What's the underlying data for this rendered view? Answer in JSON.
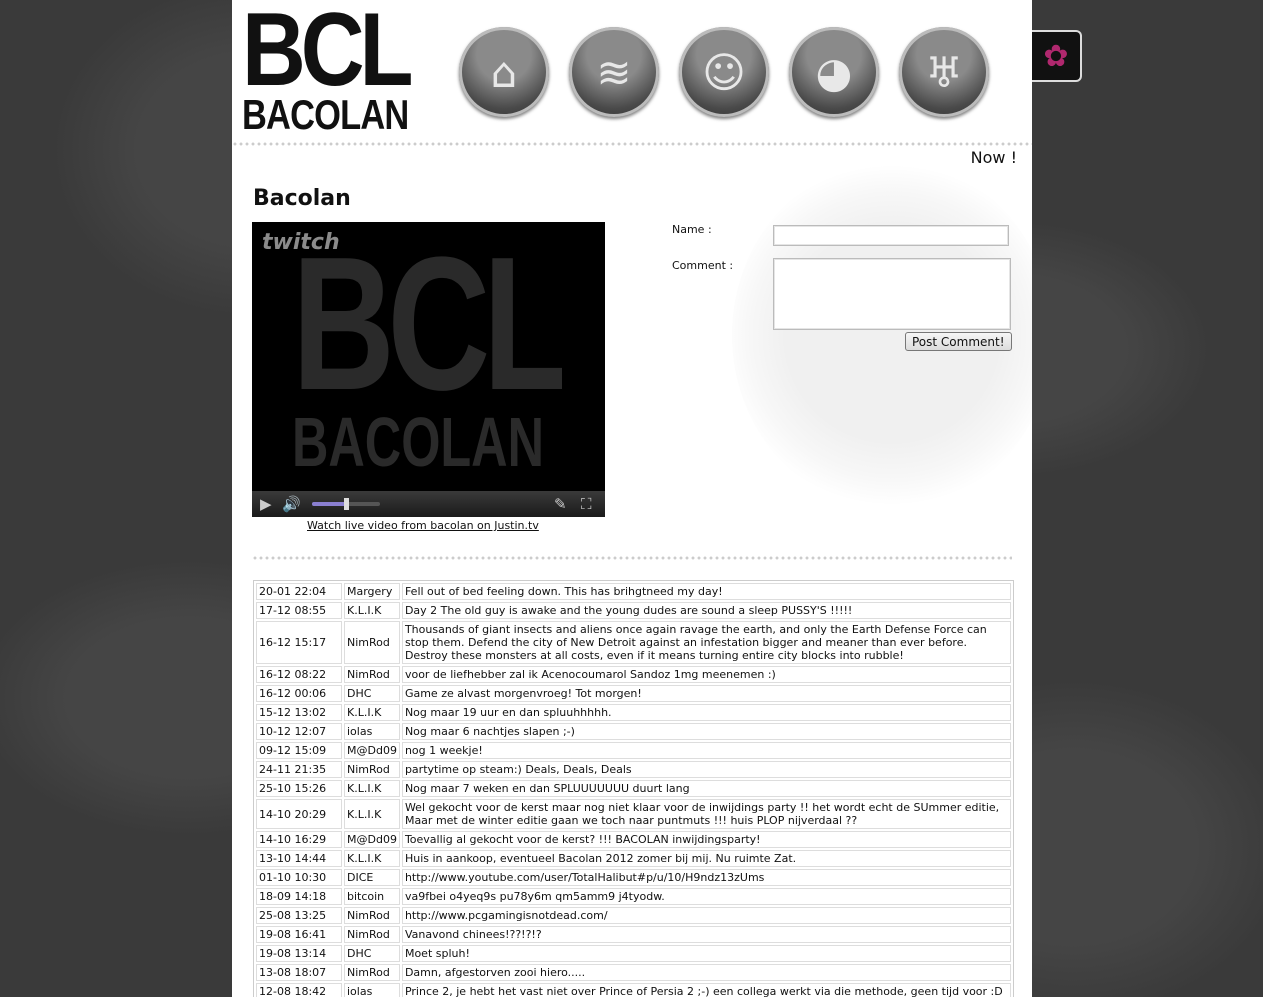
{
  "logo": {
    "top": "BCL",
    "bottom": "BACOLAN"
  },
  "nav": [
    {
      "name": "home",
      "icon": "home-icon",
      "glyph": "⌂"
    },
    {
      "name": "waves",
      "icon": "waves-icon",
      "glyph": "≋"
    },
    {
      "name": "people",
      "icon": "people-icon",
      "glyph": "☺"
    },
    {
      "name": "pacman",
      "icon": "pacman-icon",
      "glyph": "◕"
    },
    {
      "name": "bat",
      "icon": "bat-icon",
      "glyph": "♅"
    }
  ],
  "side_tab": {
    "icon": "flower-icon",
    "glyph": "✿"
  },
  "now_text": "Now !",
  "page_title": "Bacolan",
  "player": {
    "brand": "twitch",
    "screen_top": "BCL",
    "screen_bottom": "BACOLAN",
    "volume": 0.5,
    "link_text": "Watch live video from bacolan on Justin.tv"
  },
  "form": {
    "name_label": "Name :",
    "comment_label": "Comment :",
    "name_value": "",
    "comment_value": "",
    "submit_label": "Post Comment!"
  },
  "comments": [
    {
      "date": "20-01 22:04",
      "user": "Margery",
      "text": "Fell out of bed feeling down. This has brihgtneed my day!"
    },
    {
      "date": "17-12 08:55",
      "user": "K.L.I.K",
      "text": "Day 2 The old guy is awake and the young dudes are sound a sleep PUSSY'S !!!!!"
    },
    {
      "date": "16-12 15:17",
      "user": "NimRod",
      "text": "Thousands of giant insects and aliens once again ravage the earth, and only the Earth Defense Force can stop them. Defend the city of New Detroit against an infestation bigger and meaner than ever before. Destroy these monsters at all costs, even if it means turning entire city blocks into rubble!"
    },
    {
      "date": "16-12 08:22",
      "user": "NimRod",
      "text": "voor de liefhebber zal ik Acenocoumarol Sandoz 1mg meenemen :)"
    },
    {
      "date": "16-12 00:06",
      "user": "DHC",
      "text": "Game ze alvast morgenvroeg! Tot morgen!"
    },
    {
      "date": "15-12 13:02",
      "user": "K.L.I.K",
      "text": "Nog maar 19 uur en dan spluuhhhhh."
    },
    {
      "date": "10-12 12:07",
      "user": "iolas",
      "text": "Nog maar 6 nachtjes slapen ;-)"
    },
    {
      "date": "09-12 15:09",
      "user": "M@Dd09",
      "text": "nog 1 weekje!"
    },
    {
      "date": "24-11 21:35",
      "user": "NimRod",
      "text": "partytime op steam:) Deals, Deals, Deals"
    },
    {
      "date": "25-10 15:26",
      "user": "K.L.I.K",
      "text": "Nog maar 7 weken en dan SPLUUUUUUU duurt lang"
    },
    {
      "date": "14-10 20:29",
      "user": "K.L.I.K",
      "text": "Wel gekocht voor de kerst maar nog niet klaar voor de inwijdings party !! het wordt echt de SUmmer editie, Maar met de winter editie gaan we toch naar puntmuts !!! huis PLOP nijverdaal ??"
    },
    {
      "date": "14-10 16:29",
      "user": "M@Dd09",
      "text": "Toevallig al gekocht voor de kerst? !!! BACOLAN inwijdingsparty!"
    },
    {
      "date": "13-10 14:44",
      "user": "K.L.I.K",
      "text": "Huis in aankoop, eventueel Bacolan 2012 zomer bij mij. Nu ruimte Zat."
    },
    {
      "date": "01-10 10:30",
      "user": "DICE",
      "text": "http://www.youtube.com/user/TotalHalibut#p/u/10/H9ndz13zUms"
    },
    {
      "date": "18-09 14:18",
      "user": "bitcoin",
      "text": "va9fbei o4yeq9s pu78y6m qm5amm9 j4tyodw."
    },
    {
      "date": "25-08 13:25",
      "user": "NimRod",
      "text": "http://www.pcgamingisnotdead.com/"
    },
    {
      "date": "19-08 16:41",
      "user": "NimRod",
      "text": "Vanavond chinees!??!?!?"
    },
    {
      "date": "19-08 13:14",
      "user": "DHC",
      "text": "Moet spluh!"
    },
    {
      "date": "13-08 18:07",
      "user": "NimRod",
      "text": "Damn, afgestorven zooi hiero....."
    },
    {
      "date": "12-08 18:42",
      "user": "iolas",
      "text": "Prince 2, je hebt het vast niet over Prince of Persia 2 ;-) een collega werkt via die methode, geen tijd voor :D"
    }
  ]
}
